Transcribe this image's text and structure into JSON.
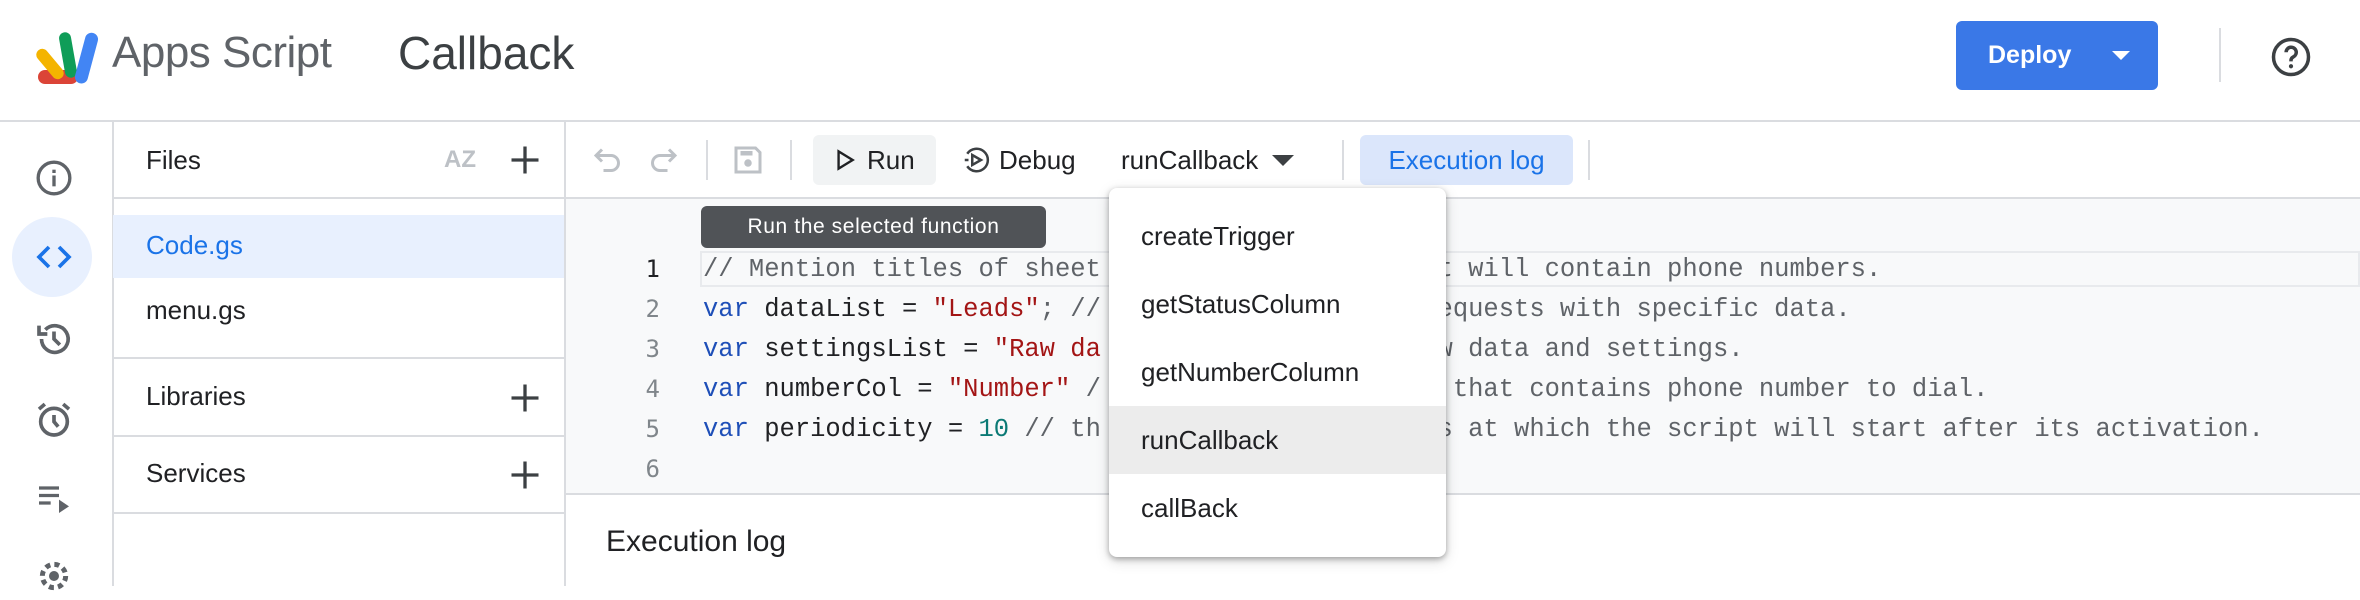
{
  "header": {
    "app_name": "Apps Script",
    "project_title": "Callback",
    "deploy_label": "Deploy",
    "help_icon": "help-circle-icon"
  },
  "rail": {
    "icons": [
      "info-icon",
      "code-editor-icon",
      "history-icon",
      "triggers-alarm-icon",
      "executions-icon",
      "settings-gear-icon"
    ],
    "active": "code-editor-icon"
  },
  "files_panel": {
    "files_label": "Files",
    "files": [
      {
        "name": "Code.gs",
        "selected": true
      },
      {
        "name": "menu.gs",
        "selected": false
      }
    ],
    "libraries_label": "Libraries",
    "services_label": "Services"
  },
  "toolbar": {
    "run_label": "Run",
    "debug_label": "Debug",
    "function_selected": "runCallback",
    "execution_log_label": "Execution log"
  },
  "tooltip": "Run the selected function",
  "editor": {
    "line_numbers": [
      "1",
      "2",
      "3",
      "4",
      "5",
      "6"
    ],
    "lines": [
      {
        "left": "// Mention titles of sheet",
        "right": "t will contain phone numbers."
      },
      {
        "kw": "var",
        "ident": " dataList = ",
        "str": "\"Leads\"",
        "rest": "; //",
        "right": "equests with specific data."
      },
      {
        "kw": "var",
        "ident": " settingsList = ",
        "str": "\"Raw da",
        "rest": "",
        "right": "w data and settings."
      },
      {
        "kw": "var",
        "ident": " numberCol = ",
        "str": "\"Number\"",
        "rest": " /",
        "right": "that contains phone number to dial."
      },
      {
        "kw": "var",
        "ident": " periodicity = ",
        "num": "10",
        "rest": " // th",
        "right": "s at which the script will start after its activation."
      }
    ]
  },
  "function_menu": {
    "items": [
      "createTrigger",
      "getStatusColumn",
      "getNumberColumn",
      "runCallback",
      "callBack"
    ],
    "highlighted": "runCallback"
  },
  "execution_log": {
    "title": "Execution log"
  },
  "colors": {
    "accent": "#1a73e8",
    "deploy": "#3a78e7",
    "selected_bg": "#e8f0fe"
  }
}
